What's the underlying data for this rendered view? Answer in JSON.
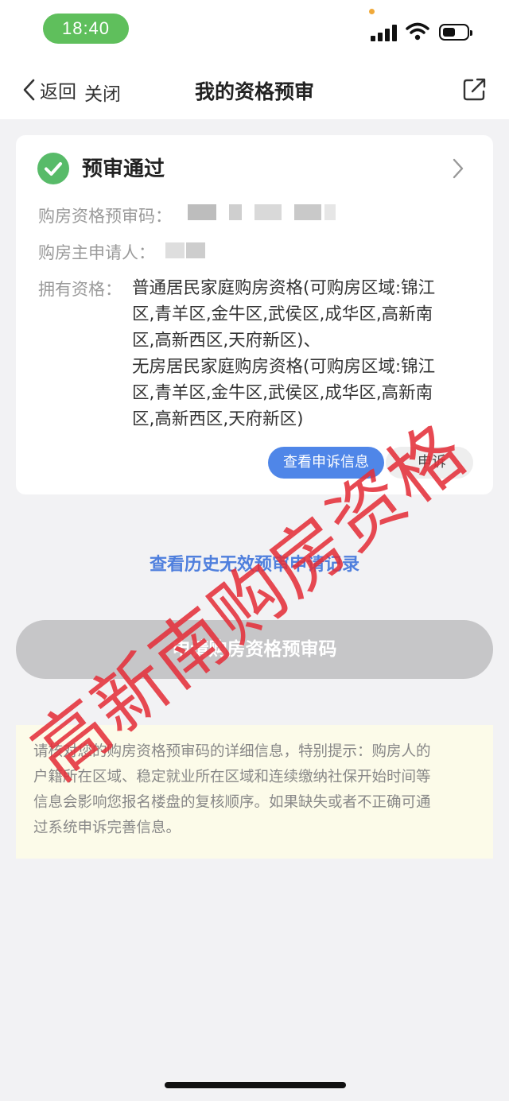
{
  "status_bar": {
    "time": "18:40"
  },
  "nav": {
    "back_label": "返回",
    "close_label": "关闭",
    "title": "我的资格预审"
  },
  "card": {
    "status_title": "预审通过",
    "code_label": "购房资格预审码：",
    "applicant_label": "购房主申请人：",
    "qualification_label": "拥有资格：",
    "qualification_lines": [
      "普通居民家庭购房资格(可购房区域:锦江",
      "区,青羊区,金牛区,武侯区,成华区,高新南",
      "区,高新西区,天府新区)、",
      "无房居民家庭购房资格(可购房区域:锦江",
      "区,青羊区,金牛区,武侯区,成华区,高新南",
      "区,高新西区,天府新区)"
    ],
    "view_appeal_label": "查看申诉信息",
    "appeal_label": "申诉"
  },
  "history_link": "查看历史无效预审申请记录",
  "apply_button": "申请购房资格预审码",
  "notice": {
    "lines": [
      "请核对您的购房资格预审码的详细信息，特别提示：购房人的",
      "户籍所在区域、稳定就业所在区域和连续缴纳社保开始时间等",
      "信息会影响您报名楼盘的复核顺序。如果缺失或者不正确可通",
      "过系统申诉完善信息。"
    ]
  },
  "watermark": "高新南购房资格",
  "colors": {
    "accent_blue": "#4f86e8",
    "link_blue": "#4f7fdd",
    "success_green": "#58bb69",
    "time_pill_green": "#5fbf5c",
    "watermark_red": "#e4303a",
    "notice_bg": "#fcfbe9"
  },
  "icons": [
    "signal-icon",
    "wifi-icon",
    "battery-icon",
    "back-chevron-icon",
    "share-icon",
    "check-circle-icon",
    "chevron-right-icon"
  ]
}
